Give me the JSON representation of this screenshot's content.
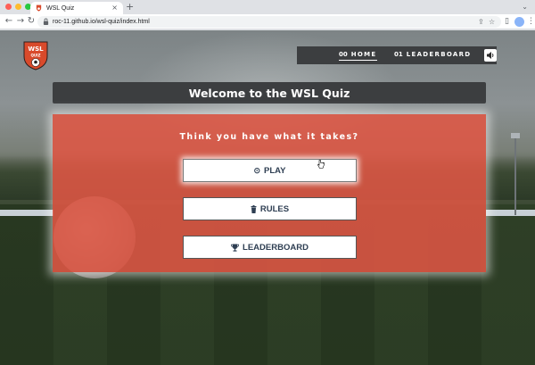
{
  "browser": {
    "tab_title": "WSL Quiz",
    "tab_close": "×",
    "new_tab": "+",
    "tab_list": "⌄",
    "back": "←",
    "forward": "→",
    "reload": "↻",
    "url": "roc-11.github.io/wsl-quiz/index.html",
    "share_icon": "⇪",
    "bookmark_icon": "☆",
    "menu_icon": "⋮",
    "sidebar_icon": "▯"
  },
  "nav": {
    "items": [
      {
        "num": "00",
        "label": "HOME",
        "active": true
      },
      {
        "num": "01",
        "label": "LEADERBOARD",
        "active": false
      }
    ],
    "sound_icon": "speaker-icon"
  },
  "header": {
    "title": "Welcome to the WSL Quiz"
  },
  "panel": {
    "tagline": "Think you have what it takes?",
    "buttons": {
      "play": {
        "icon": "⊙",
        "label": "PLAY"
      },
      "rules": {
        "icon": "▮",
        "label": "RULES"
      },
      "leaderboard": {
        "icon": "🏆︎",
        "label": "LEADERBOARD"
      }
    }
  },
  "logo": {
    "text_top": "WSL",
    "text_bottom": "QUIZ"
  },
  "colors": {
    "panel": "#df5744",
    "navbar": "#3c3e40",
    "button_text": "#2e3e52",
    "logo": "#d94a2b"
  }
}
